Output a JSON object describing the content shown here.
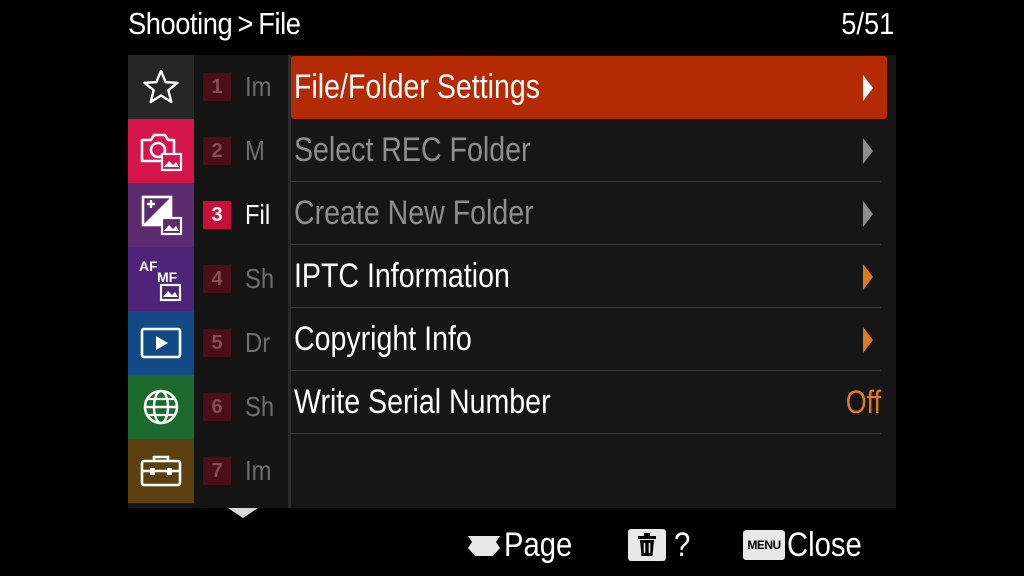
{
  "header": {
    "tab_name": "Shooting",
    "separator": ">",
    "section": "File",
    "page_counter": "5/51"
  },
  "categories": [
    {
      "name": "favorites",
      "icon": "star-icon",
      "color": "#262626"
    },
    {
      "name": "shooting",
      "icon": "camera-photo-icon",
      "color": "#d4144a"
    },
    {
      "name": "exposure-color",
      "icon": "exposure-photo-icon",
      "color": "#5c2a6e"
    },
    {
      "name": "focus",
      "icon": "af-mf-icon",
      "color": "#50237a"
    },
    {
      "name": "playback",
      "icon": "playback-icon",
      "color": "#124a86"
    },
    {
      "name": "network",
      "icon": "globe-icon",
      "color": "#1d6a2e"
    },
    {
      "name": "setup",
      "icon": "toolbox-icon",
      "color": "#5c4010"
    }
  ],
  "pages": [
    {
      "num": "1",
      "name": "Im"
    },
    {
      "num": "2",
      "name": "M"
    },
    {
      "num": "3",
      "name": "Fil"
    },
    {
      "num": "4",
      "name": "Sh"
    },
    {
      "num": "5",
      "name": "Dr"
    },
    {
      "num": "6",
      "name": "Sh"
    },
    {
      "num": "7",
      "name": "Im"
    }
  ],
  "menu_items": [
    {
      "label": "File/Folder Settings",
      "state": "selected",
      "has_arrow": true
    },
    {
      "label": "Select REC Folder",
      "state": "disabled",
      "has_arrow": true
    },
    {
      "label": "Create New Folder",
      "state": "disabled",
      "has_arrow": true
    },
    {
      "label": "IPTC Information",
      "state": "enabled",
      "has_arrow": true
    },
    {
      "label": "Copyright Info",
      "state": "enabled",
      "has_arrow": true
    },
    {
      "label": "Write Serial Number",
      "state": "enabled",
      "value": "Off"
    }
  ],
  "footer": {
    "page_label": "Page",
    "help_label": "?",
    "menu_key_label": "MENU",
    "close_label": "Close"
  },
  "colors": {
    "selected_bg": "#b42a05",
    "accent_orange": "#e07a1e",
    "active_page": "#c8103a"
  }
}
